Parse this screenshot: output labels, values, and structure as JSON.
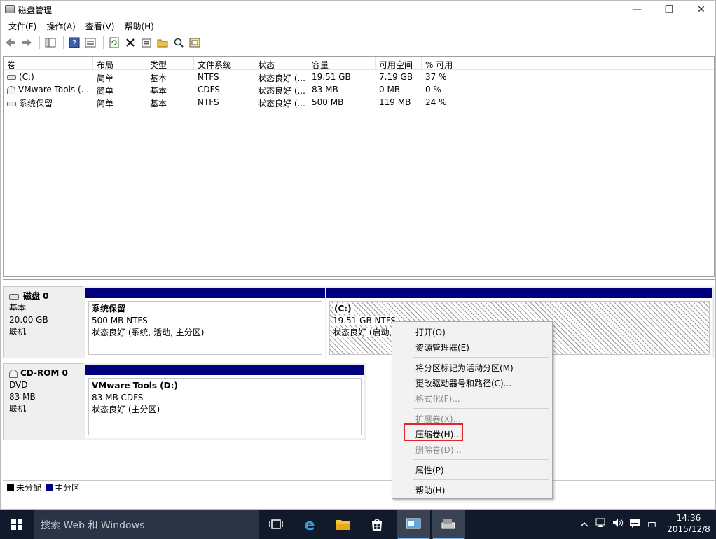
{
  "window": {
    "title": "磁盘管理",
    "controls": {
      "minimize": "—",
      "maximize": "❐",
      "close": "✕"
    }
  },
  "menu": [
    "文件(F)",
    "操作(A)",
    "查看(V)",
    "帮助(H)"
  ],
  "toolbar_icons": [
    "back-icon",
    "forward-icon",
    "console-tree-icon",
    "help-icon",
    "details-icon",
    "refresh-icon",
    "delete-icon",
    "properties-icon",
    "open-icon",
    "explore-icon",
    "format-icon"
  ],
  "volume_table": {
    "columns": [
      "卷",
      "布局",
      "类型",
      "文件系统",
      "状态",
      "容量",
      "可用空间",
      "% 可用"
    ],
    "rows": [
      {
        "name": "(C:)",
        "layout": "简单",
        "type": "基本",
        "fs": "NTFS",
        "status": "状态良好 (...",
        "capacity": "19.51 GB",
        "free": "7.19 GB",
        "pct": "37 %",
        "icon": "drive-icon"
      },
      {
        "name": "VMware Tools (...",
        "layout": "简单",
        "type": "基本",
        "fs": "CDFS",
        "status": "状态良好 (...",
        "capacity": "83 MB",
        "free": "0 MB",
        "pct": "0 %",
        "icon": "cdrom-icon"
      },
      {
        "name": "系统保留",
        "layout": "简单",
        "type": "基本",
        "fs": "NTFS",
        "status": "状态良好 (...",
        "capacity": "500 MB",
        "free": "119 MB",
        "pct": "24 %",
        "icon": "drive-icon"
      }
    ]
  },
  "disks": [
    {
      "title": "磁盘 0",
      "kind": "基本",
      "size": "20.00 GB",
      "state": "联机",
      "partitions": [
        {
          "title": "系统保留",
          "line2": "500 MB NTFS",
          "line3": "状态良好 (系统, 活动, 主分区)"
        },
        {
          "title": "(C:)",
          "line2": "19.51 GB NTFS",
          "line3": "状态良好 (启动,"
        }
      ]
    },
    {
      "title": "CD-ROM 0",
      "kind": "DVD",
      "size": "83 MB",
      "state": "联机",
      "partitions": [
        {
          "title": "VMware Tools  (D:)",
          "line2": "83 MB CDFS",
          "line3": "状态良好 (主分区)"
        }
      ]
    }
  ],
  "legend": {
    "unallocated": "未分配",
    "primary": "主分区",
    "unallocated_color": "#000000",
    "primary_color": "#00007f"
  },
  "context_menu": {
    "open": "打开(O)",
    "explorer": "资源管理器(E)",
    "mark_active": "将分区标记为活动分区(M)",
    "change_letter": "更改驱动器号和路径(C)...",
    "format": "格式化(F)...",
    "extend": "扩展卷(X)...",
    "shrink": "压缩卷(H)...",
    "delete": "删除卷(D)...",
    "properties": "属性(P)",
    "help": "帮助(H)"
  },
  "taskbar": {
    "search_placeholder": "搜索 Web 和 Windows",
    "ime": "中",
    "time": "14:36",
    "date": "2015/12/8"
  }
}
